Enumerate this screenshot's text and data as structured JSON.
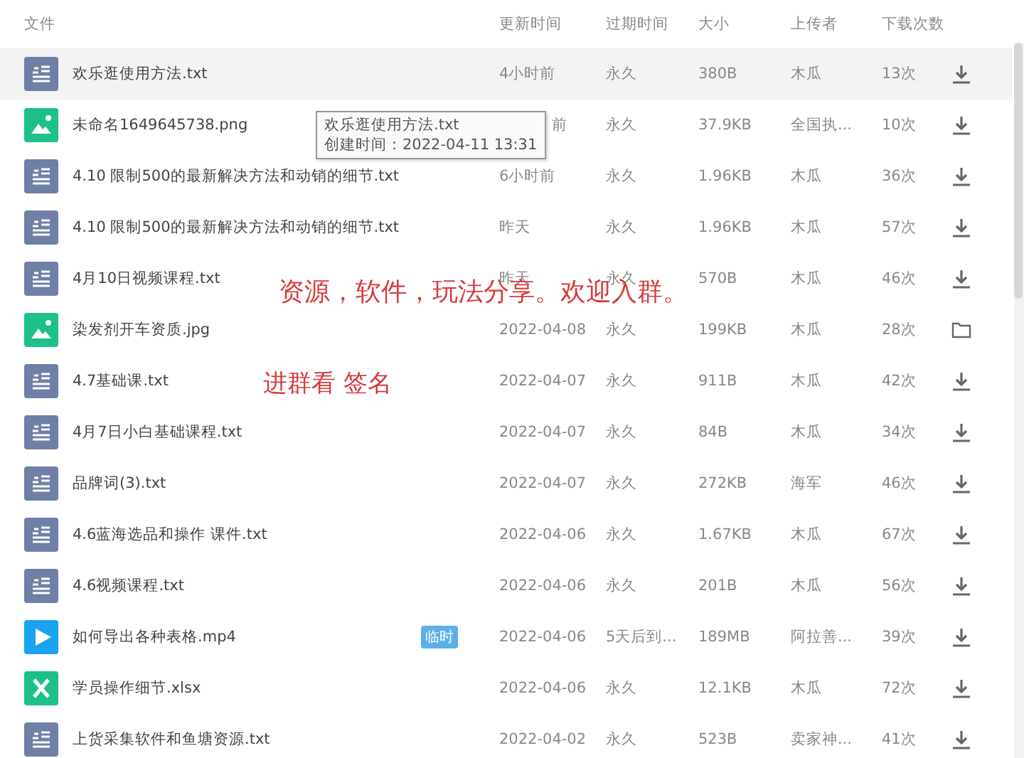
{
  "table": {
    "columns": [
      "文件",
      "更新时间",
      "过期时间",
      "大小",
      "上传者",
      "下载次数"
    ],
    "rows": [
      {
        "kind": "text",
        "name": "欢乐逛使用方法.txt",
        "updated": "4小时前",
        "expires": "永久",
        "size": "380B",
        "uploader": "木瓜",
        "downloads": "13次",
        "action": {
          "kind": "download"
        },
        "hovered": true
      },
      {
        "kind": "image",
        "name": "未命名1649645738.png",
        "updated": "前",
        "expires": "永久",
        "size": "37.9KB",
        "uploader": "全国执...",
        "downloads": "10次",
        "action": {
          "kind": "download"
        },
        "hovered": false
      },
      {
        "kind": "text",
        "name": "4.10 限制500的最新解决方法和动销的细节.txt",
        "updated": "6小时前",
        "expires": "永久",
        "size": "1.96KB",
        "uploader": "木瓜",
        "downloads": "36次",
        "action": {
          "kind": "download"
        },
        "hovered": false
      },
      {
        "kind": "text",
        "name": "4.10 限制500的最新解决方法和动销的细节.txt",
        "updated": "昨天",
        "expires": "永久",
        "size": "1.96KB",
        "uploader": "木瓜",
        "downloads": "57次",
        "action": {
          "kind": "download"
        },
        "hovered": false
      },
      {
        "kind": "text",
        "name": "4月10日视频课程.txt",
        "updated": "昨天",
        "expires": "永久",
        "size": "570B",
        "uploader": "木瓜",
        "downloads": "46次",
        "action": {
          "kind": "download"
        },
        "hovered": false
      },
      {
        "kind": "image",
        "name": "染发剂开车资质.jpg",
        "updated": "2022-04-08",
        "expires": "永久",
        "size": "199KB",
        "uploader": "木瓜",
        "downloads": "28次",
        "action": {
          "kind": "folder"
        },
        "hovered": false
      },
      {
        "kind": "text",
        "name": "4.7基础课.txt",
        "updated": "2022-04-07",
        "expires": "永久",
        "size": "911B",
        "uploader": "木瓜",
        "downloads": "42次",
        "action": {
          "kind": "download"
        },
        "hovered": false
      },
      {
        "kind": "text",
        "name": "4月7日小白基础课程.txt",
        "updated": "2022-04-07",
        "expires": "永久",
        "size": "84B",
        "uploader": "木瓜",
        "downloads": "34次",
        "action": {
          "kind": "download"
        },
        "hovered": false
      },
      {
        "kind": "text",
        "name": "品牌词(3).txt",
        "updated": "2022-04-07",
        "expires": "永久",
        "size": "272KB",
        "uploader": "海军",
        "downloads": "46次",
        "action": {
          "kind": "download"
        },
        "hovered": false
      },
      {
        "kind": "text",
        "name": "4.6蓝海选品和操作  课件.txt",
        "updated": "2022-04-06",
        "expires": "永久",
        "size": "1.67KB",
        "uploader": "木瓜",
        "downloads": "67次",
        "action": {
          "kind": "download"
        },
        "hovered": false
      },
      {
        "kind": "text",
        "name": "4.6视频课程.txt",
        "updated": "2022-04-06",
        "expires": "永久",
        "size": "201B",
        "uploader": "木瓜",
        "downloads": "56次",
        "action": {
          "kind": "download"
        },
        "hovered": false
      },
      {
        "kind": "video",
        "name": "如何导出各种表格.mp4",
        "badge": "临时",
        "updated": "2022-04-06",
        "expires": "5天后到...",
        "size": "189MB",
        "uploader": "阿拉善...",
        "downloads": "39次",
        "action": {
          "kind": "download"
        },
        "hovered": false
      },
      {
        "kind": "sheet",
        "name": "学员操作细节.xlsx",
        "updated": "2022-04-06",
        "expires": "永久",
        "size": "12.1KB",
        "uploader": "木瓜",
        "downloads": "72次",
        "action": {
          "kind": "download"
        },
        "hovered": false
      },
      {
        "kind": "text",
        "name": "上货采集软件和鱼塘资源.txt",
        "updated": "2022-04-02",
        "expires": "永久",
        "size": "523B",
        "uploader": "卖家神...",
        "downloads": "41次",
        "action": {
          "kind": "download"
        },
        "hovered": false
      }
    ]
  },
  "tooltip": {
    "title": "欢乐逛使用方法.txt",
    "created": "创建时间：2022-04-11 13:31"
  },
  "annotations": [
    "资源，软件，玩法分享。欢迎入群。",
    "进群看 签名"
  ]
}
